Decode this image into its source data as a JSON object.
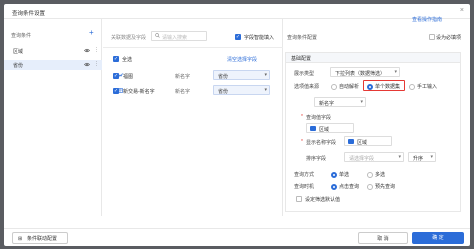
{
  "dialog": {
    "title": "查询条件设置",
    "close_glyph": "×"
  },
  "left_panel": {
    "header": "查询条件",
    "add_glyph": "+",
    "items": [
      {
        "label": "区域",
        "selected": false
      },
      {
        "label": "省份",
        "selected": true
      }
    ]
  },
  "middle_panel": {
    "header": "关联数据及字段",
    "search_placeholder": "请输入搜索",
    "smart_checkbox_label": "字段智能填入",
    "select_all_label": "全选",
    "clear_label": "清空选择字段",
    "datasets": [
      {
        "name": "福图",
        "field": "新名字",
        "tag": "省份",
        "icon_color": "#2b6cd8"
      },
      {
        "name": "新交易-新名字",
        "field": "新名字",
        "tag": "省份",
        "icon_color": "#2b6cd8"
      }
    ]
  },
  "right_panel": {
    "name_label": "查询条件配置",
    "help_link": "查看操作指南",
    "required_label": "设为必填项",
    "section_header": "基础配置",
    "display_type_label": "展示类型",
    "display_type_value": "下拉列表（数据筛选）",
    "value_source_label": "选项值来源",
    "value_source_options": [
      "自动解析",
      "单个数据集",
      "手工输入"
    ],
    "value_source_selected": 1,
    "dataset_value": "新名字",
    "query_field_label": "查询值字段",
    "query_field_value": "区域",
    "display_field_label": "显示名称字段",
    "display_field_value": "区域",
    "sort_label": "排序字段",
    "sort_placeholder": "请选择字段",
    "sort_order": "升序",
    "query_mode_label": "查询方式",
    "query_mode_options": [
      "单选",
      "多选"
    ],
    "query_mode_selected": 0,
    "trigger_label": "查询时机",
    "trigger_options": [
      "点击查询",
      "预先查询"
    ],
    "trigger_selected": 0,
    "default_label": "设定筛选默认值"
  },
  "footer": {
    "linkage_button": "条件联动配置",
    "cancel_button": "取 消",
    "ok_button": "确 定"
  },
  "colors": {
    "accent": "#2b6cd8",
    "highlight_border": "#e53935",
    "overlay": "#5a5c61"
  }
}
